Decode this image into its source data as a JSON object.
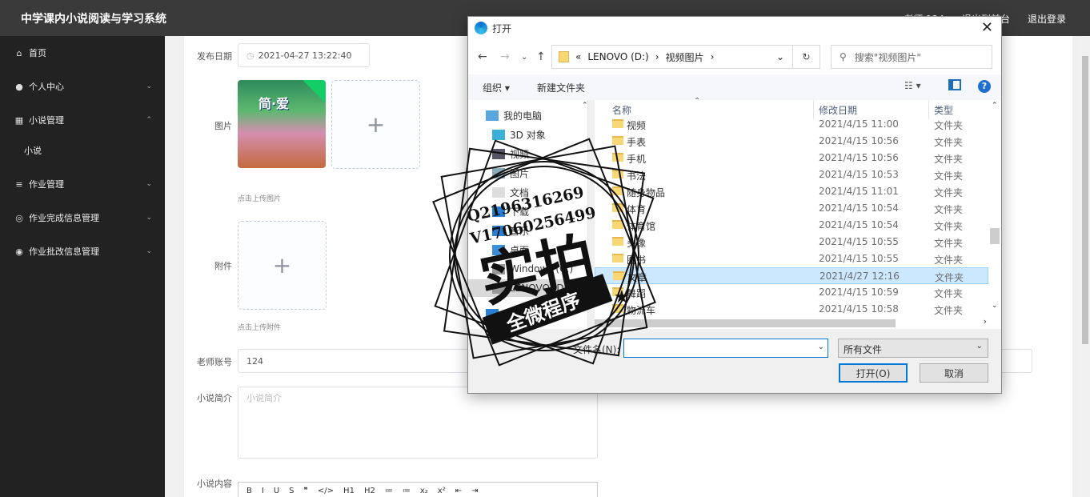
{
  "app": {
    "title": "中学课内小说阅读与学习系统",
    "top_right": [
      "老师 124",
      "退出到前台",
      "退出登录"
    ]
  },
  "sidebar": {
    "items": [
      {
        "label": "首页",
        "icon": "home-icon",
        "glyph": "⌂"
      },
      {
        "label": "个人中心",
        "icon": "user-icon",
        "glyph": "●"
      },
      {
        "label": "小说管理",
        "icon": "grid-icon",
        "glyph": "▦"
      },
      {
        "label": "小说",
        "icon": "",
        "glyph": ""
      },
      {
        "label": "作业管理",
        "icon": "list-icon",
        "glyph": "≡"
      },
      {
        "label": "作业完成信息管理",
        "icon": "circle-icon",
        "glyph": "◎"
      },
      {
        "label": "作业批改信息管理",
        "icon": "compass-icon",
        "glyph": "◉"
      }
    ]
  },
  "form": {
    "publish_date_label": "发布日期",
    "publish_date_value": "2021-04-27 13:22:40",
    "image_label": "图片",
    "image_hint": "点击上传图片",
    "thumb_text": "简·爱",
    "attachment_label": "附件",
    "attachment_hint": "点击上传附件",
    "teacher_label": "老师账号",
    "teacher_value": "124",
    "intro_label": "小说简介",
    "intro_placeholder": "小说简介",
    "content_label": "小说内容",
    "editor_tools": [
      "B",
      "I",
      "U",
      "S",
      "❞",
      "</>",
      "H1",
      "H2",
      "≔",
      "≔",
      "x₂",
      "x²",
      "⇤",
      "⇥"
    ]
  },
  "dialog": {
    "title": "打开",
    "path": [
      "«",
      "LENOVO (D:)",
      "›",
      "视频图片",
      "›"
    ],
    "search_placeholder": "搜索\"视频图片\"",
    "organize": "组织 ▾",
    "new_folder": "新建文件夹",
    "tree": [
      "我的电脑",
      "3D 对象",
      "视频",
      "图片",
      "文档",
      "下载",
      "音乐",
      "桌面",
      "Windows (C:)",
      "LENOVO (D:)",
      "网络"
    ],
    "columns": {
      "name": "名称",
      "date": "修改日期",
      "type": "类型"
    },
    "files": [
      {
        "name": "视频",
        "date": "2021/4/15 11:00",
        "type": "文件夹"
      },
      {
        "name": "手表",
        "date": "2021/4/15 10:56",
        "type": "文件夹"
      },
      {
        "name": "手机",
        "date": "2021/4/15 10:56",
        "type": "文件夹"
      },
      {
        "name": "书法",
        "date": "2021/4/15 10:53",
        "type": "文件夹"
      },
      {
        "name": "随身物品",
        "date": "2021/4/15 11:01",
        "type": "文件夹"
      },
      {
        "name": "体育",
        "date": "2021/4/15 10:54",
        "type": "文件夹"
      },
      {
        "name": "体育馆",
        "date": "2021/4/15 10:54",
        "type": "文件夹"
      },
      {
        "name": "头像",
        "date": "2021/4/15 10:55",
        "type": "文件夹"
      },
      {
        "name": "图书",
        "date": "2021/4/15 10:55",
        "type": "文件夹"
      },
      {
        "name": "文章",
        "date": "2021/4/27 12:16",
        "type": "文件夹"
      },
      {
        "name": "舞蹈",
        "date": "2021/4/15 10:59",
        "type": "文件夹"
      },
      {
        "name": "物流车",
        "date": "2021/4/15 10:58",
        "type": "文件夹"
      }
    ],
    "selected_index": 9,
    "filename_label": "文件名(N):",
    "filename_value": "",
    "filter": "所有文件",
    "open_button": "打开(O)",
    "cancel_button": "取消"
  },
  "watermark": {
    "lines": [
      "Q2196316269",
      "V17060256499",
      "实拍",
      "全微程序"
    ]
  }
}
